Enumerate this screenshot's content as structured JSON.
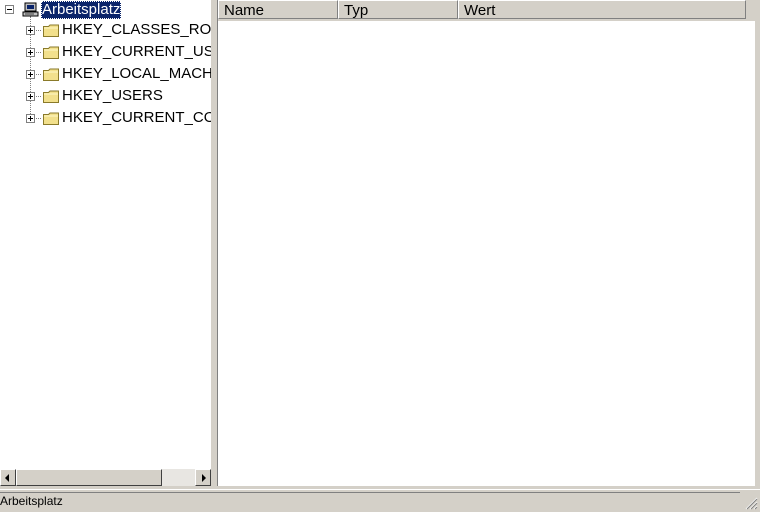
{
  "tree": {
    "root": {
      "label": "Arbeitsplatz",
      "icon": "computer-icon",
      "expanded": true,
      "selected": true
    },
    "children": [
      {
        "label": "HKEY_CLASSES_ROOT",
        "icon": "folder-icon",
        "expanded": false
      },
      {
        "label": "HKEY_CURRENT_USER",
        "icon": "folder-icon",
        "expanded": false
      },
      {
        "label": "HKEY_LOCAL_MACHINE",
        "icon": "folder-icon",
        "expanded": false
      },
      {
        "label": "HKEY_USERS",
        "icon": "folder-icon",
        "expanded": false
      },
      {
        "label": "HKEY_CURRENT_CONFIG",
        "icon": "folder-icon",
        "expanded": false
      }
    ]
  },
  "list": {
    "columns": [
      "Name",
      "Typ",
      "Wert"
    ],
    "rows": []
  },
  "status_bar": {
    "text": "Arbeitsplatz"
  },
  "colors": {
    "selection": "#0a246a",
    "folder": "#f2e08c",
    "chrome": "#d4d0c8"
  }
}
